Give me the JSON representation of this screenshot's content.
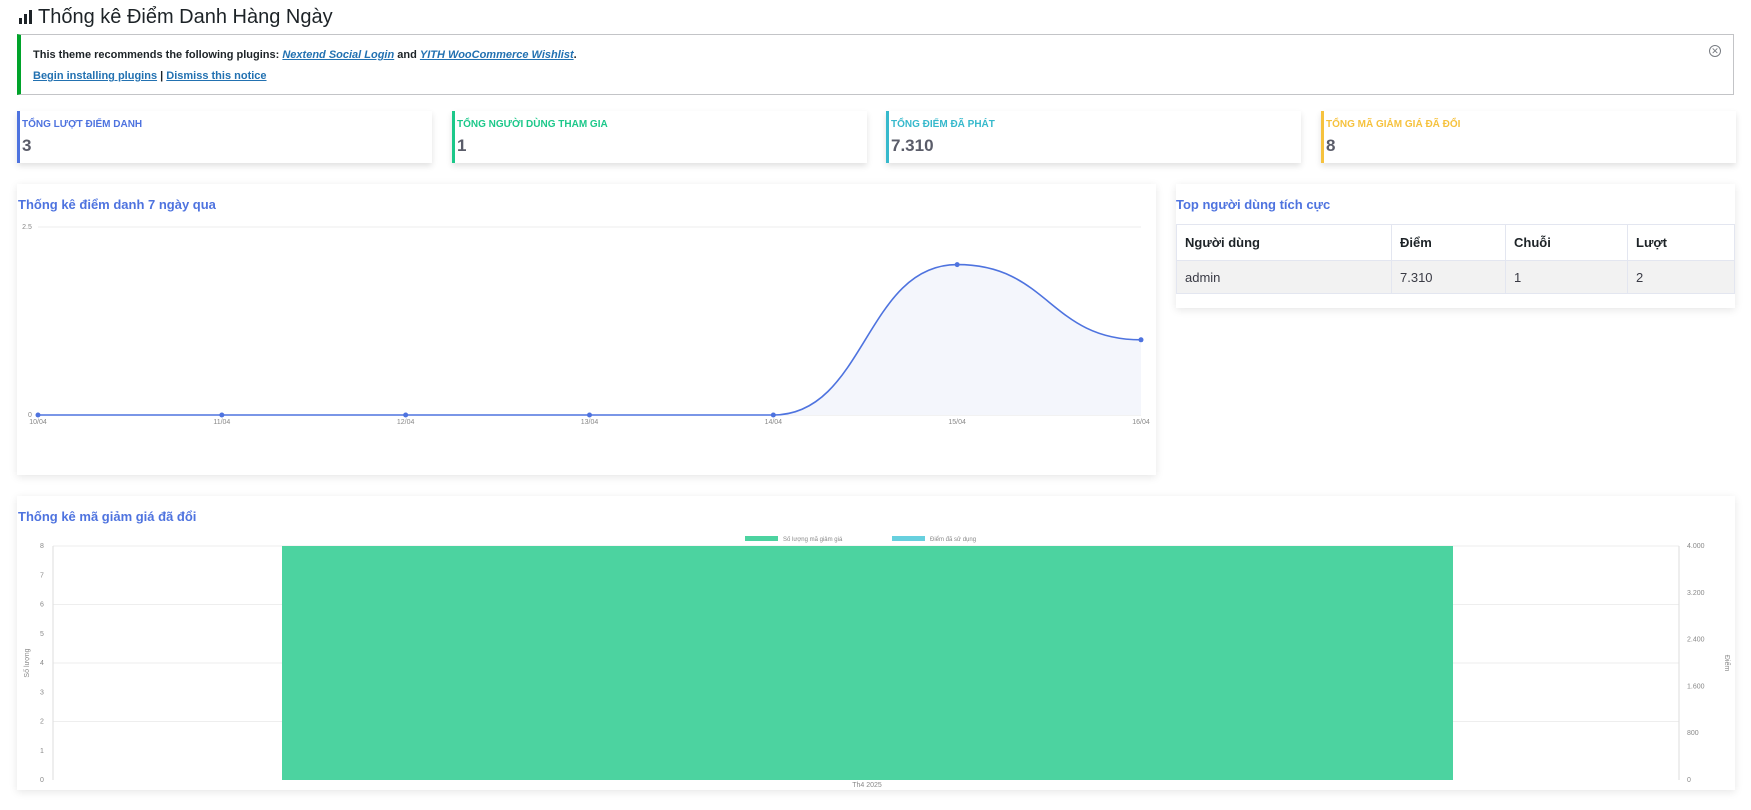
{
  "page": {
    "title": "Thống kê Điểm Danh Hàng Ngày",
    "title_icon": "bar-chart-icon"
  },
  "notice": {
    "text_before": "This theme recommends the following plugins:",
    "plugin1": "Nextend Social Login",
    "and_text": "and",
    "plugin2": "YITH WooCommerce Wishlist",
    "period": ".",
    "begin_link": "Begin installing plugins",
    "separator": "|",
    "dismiss_link": "Dismiss this notice",
    "dismiss_icon": "close-circle-icon"
  },
  "stats": [
    {
      "label": "Tổng lượt điểm danh",
      "value": "3",
      "color": "#4e73df"
    },
    {
      "label": "Tổng người dùng tham gia",
      "value": "1",
      "color": "#1cc88a"
    },
    {
      "label": "Tổng điểm đã phát",
      "value": "7.310",
      "color": "#36b9cc"
    },
    {
      "label": "Tổng mã giảm giá đã đổi",
      "value": "8",
      "color": "#f6c23e"
    }
  ],
  "line_card": {
    "title": "Thống kê điểm danh 7 ngày qua"
  },
  "top_users": {
    "title": "Top người dùng tích cực",
    "columns": [
      "Người dùng",
      "Điểm",
      "Chuỗi",
      "Lượt"
    ],
    "rows": [
      [
        "admin",
        "7.310",
        "1",
        "2"
      ]
    ]
  },
  "bar_card": {
    "title": "Thống kê mã giảm giá đã đổi"
  },
  "chart_data": [
    {
      "type": "line",
      "x": [
        "10/04",
        "11/04",
        "12/04",
        "13/04",
        "14/04",
        "15/04",
        "16/04"
      ],
      "series": [
        {
          "values": [
            0,
            0,
            0,
            0,
            0,
            2,
            1
          ]
        }
      ],
      "ylim": [
        0,
        2.5
      ],
      "y_ticks": [
        "0",
        "2.5"
      ],
      "fill": true,
      "color": "#4e73df",
      "fill_color": "#f4f6fc"
    },
    {
      "type": "bar",
      "categories": [
        "Th4 2025"
      ],
      "series": [
        {
          "name": "Số lượng mã giảm giá",
          "values": [
            8
          ],
          "color": "#4cd3a0"
        },
        {
          "name": "Điểm đã sử dụng",
          "values": [
            4000
          ],
          "color": "#67d0de"
        }
      ],
      "ylim_left": [
        0,
        8
      ],
      "ylim_right": [
        0,
        4000
      ],
      "y_left_ticks": [
        "0",
        "1",
        "2",
        "3",
        "4",
        "5",
        "6",
        "7",
        "8"
      ],
      "y_right_ticks": [
        "0",
        "800",
        "1.600",
        "2.400",
        "3.200",
        "4.000"
      ],
      "ylabel_left": "Số lượng",
      "ylabel_right": "Điểm",
      "legend": "top",
      "grid": true
    }
  ]
}
